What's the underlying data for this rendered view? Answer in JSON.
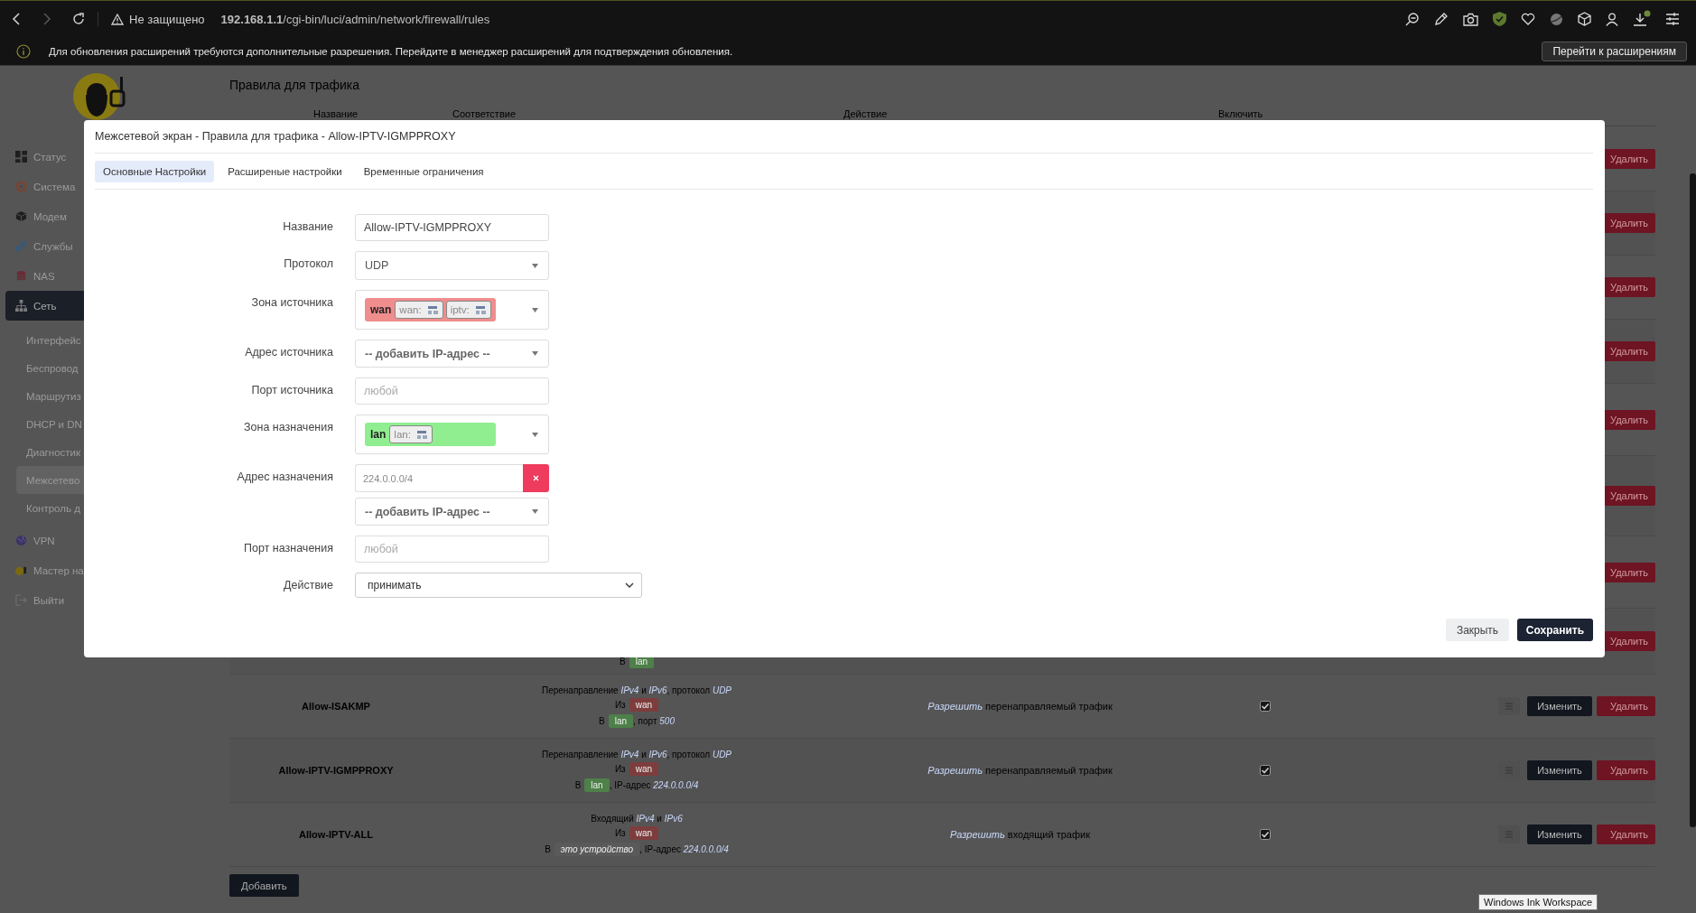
{
  "browser": {
    "security_label": "Не защищено",
    "url": "**192.168.1.1**/cgi-bin/luci/admin/network/firewall/rules",
    "notice": "Для обновления расширений требуются дополнительные разрешения. Перейдите в менеджер расширений для подтверждения обновления.",
    "notice_button": "Перейти к расширениям"
  },
  "sidebar": {
    "items": [
      {
        "label": "Статус",
        "selected": false
      },
      {
        "label": "Система",
        "selected": false
      },
      {
        "label": "Модем",
        "selected": false
      },
      {
        "label": "Службы",
        "selected": false
      },
      {
        "label": "NAS",
        "selected": false
      },
      {
        "label": "Сеть",
        "selected": true,
        "children": [
          {
            "label": "Интерфейс",
            "selected": false
          },
          {
            "label": "Беспровод",
            "selected": false
          },
          {
            "label": "Маршрутиз",
            "selected": false
          },
          {
            "label": "DHCP и DN",
            "selected": false
          },
          {
            "label": "Диагностик",
            "selected": false
          },
          {
            "label": "Межсетево",
            "selected": true
          },
          {
            "label": "Контроль д",
            "selected": false
          }
        ]
      },
      {
        "label": "VPN",
        "selected": false
      },
      {
        "label": "Мастер на",
        "selected": false
      },
      {
        "label": "Выйти",
        "selected": false
      }
    ]
  },
  "page": {
    "title": "Правила для трафика",
    "columns": [
      "Название",
      "Соответствие",
      "Действие",
      "Включить"
    ],
    "rows": [
      {
        "delete_label": "Удалить"
      },
      {
        "delete_label": "Удалить"
      },
      {
        "delete_label": "Удалить"
      },
      {
        "delete_label": "Удалить"
      },
      {
        "delete_label": "Удалить"
      },
      {
        "delete_label": "Удалить"
      },
      {
        "delete_label": "Удалить"
      },
      {
        "match": [
          {
            "prefix": "В",
            "zone": {
              "label": "lan",
              "color": "#4e8049"
            }
          }
        ],
        "delete_label": "Удалить"
      },
      {
        "name": "Allow-ISAKMP",
        "match": [
          {
            "text": "Перенаправление *IPv4* и *IPv6*, протокол *UDP*"
          },
          {
            "prefix": "Из",
            "zone": {
              "label": "wan",
              "color": "#7e3d3d"
            }
          },
          {
            "prefix": "В",
            "zone": {
              "label": "lan",
              "color": "#4e8049"
            },
            "suffix": ", порт *500*"
          }
        ],
        "action": "*Разрешить* перенаправляемый трафик",
        "enabled": true,
        "edit_label": "Изменить",
        "delete_label": "Удалить"
      },
      {
        "name": "Allow-IPTV-IGMPPROXY",
        "match": [
          {
            "text": "Перенаправление *IPv4* и *IPv6*, протокол *UDP*"
          },
          {
            "prefix": "Из",
            "zone": {
              "label": "wan",
              "color": "#7e3d3d"
            }
          },
          {
            "prefix": "В",
            "zone": {
              "label": "lan",
              "color": "#4e8049"
            },
            "suffix": ", IP-адрес *224.0.0.0/4*"
          }
        ],
        "action": "*Разрешить* перенаправляемый трафик",
        "enabled": true,
        "edit_label": "Изменить",
        "delete_label": "Удалить"
      },
      {
        "name": "Allow-IPTV-ALL",
        "match": [
          {
            "text": "Входящий *IPv4* и *IPv6*"
          },
          {
            "prefix": "Из",
            "zone": {
              "label": "wan",
              "color": "#7e3d3d"
            }
          },
          {
            "prefix": "В",
            "zone": {
              "label": "*это устройство*",
              "color": "#5a5a5a"
            },
            "suffix": ", IP-адрес *224.0.0.0/4*"
          }
        ],
        "action": "*Разрешить* входящий трафик",
        "enabled": true,
        "edit_label": "Изменить",
        "delete_label": "Удалить"
      }
    ],
    "add_button": "Добавить"
  },
  "modal": {
    "title": "Межсетевой экран - Правила для трафика - Allow-IPTV-IGMPPROXY",
    "tabs": [
      {
        "label": "Основные Настройки",
        "selected": true
      },
      {
        "label": "Расширеные настройки",
        "selected": false
      },
      {
        "label": "Временные ограничения",
        "selected": false
      }
    ],
    "fields": [
      {
        "kind": "text",
        "label": "Название",
        "value": "Allow-IPTV-IGMPPROXY"
      },
      {
        "kind": "select",
        "label": "Протокол",
        "value": "UDP"
      },
      {
        "kind": "zones",
        "label": "Зона источника",
        "zone": {
          "name": "wan",
          "color": "#f08d8d",
          "networks": [
            "wan:",
            "iptv:"
          ]
        }
      },
      {
        "kind": "address",
        "label": "Адрес источника",
        "add_label": "-- добавить IP-адрес --"
      },
      {
        "kind": "text",
        "label": "Порт источника",
        "placeholder": "любой"
      },
      {
        "kind": "zones",
        "label": "Зона назначения",
        "zone": {
          "name": "lan",
          "color": "#90ee90",
          "networks": [
            "lan:"
          ]
        }
      },
      {
        "kind": "address",
        "label": "Адрес назначения",
        "entries": [
          "224.0.0.0/4"
        ],
        "add_label": "-- добавить IP-адрес --"
      },
      {
        "kind": "text",
        "label": "Порт назначения",
        "placeholder": "любой"
      },
      {
        "kind": "dropdown",
        "label": "Действие",
        "value": "принимать"
      }
    ],
    "buttons": [
      {
        "label": "Закрыть",
        "kind": "secondary"
      },
      {
        "label": "Сохранить",
        "kind": "primary"
      }
    ]
  },
  "tooltip": "Windows Ink Workspace"
}
